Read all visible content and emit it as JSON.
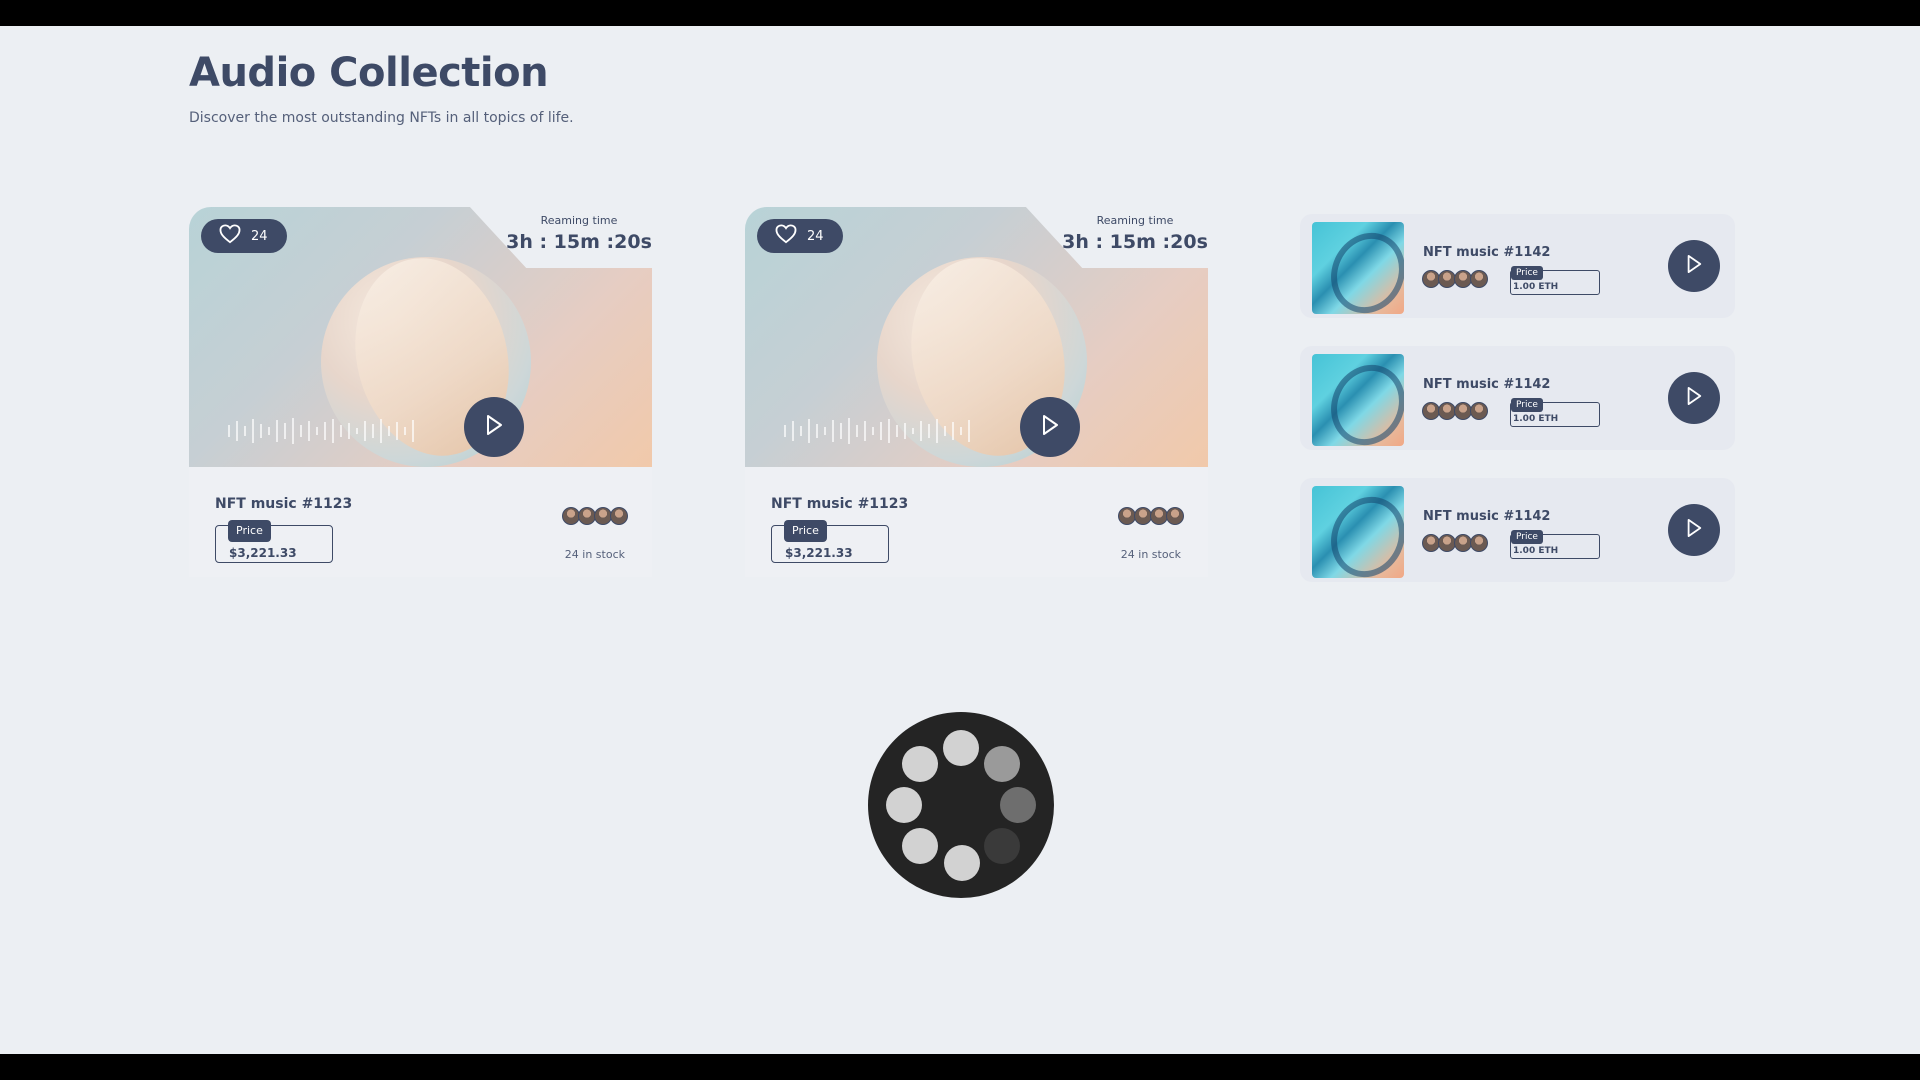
{
  "page": {
    "title": "Audio Collection",
    "subtitle": "Discover the most outstanding NFTs in all topics of life."
  },
  "featured": [
    {
      "likes": "24",
      "remaining_label": "Reaming time",
      "remaining_time": "3h : 15m :20s",
      "name": "NFT music #1123",
      "price_label": "Price",
      "price": "$3,221.33",
      "stock": "24 in stock"
    },
    {
      "likes": "24",
      "remaining_label": "Reaming time",
      "remaining_time": "3h : 15m :20s",
      "name": "NFT music #1123",
      "price_label": "Price",
      "price": "$3,221.33",
      "stock": "24 in stock"
    }
  ],
  "list": [
    {
      "name": "NFT music #1142",
      "price_label": "Price",
      "price": "1.00 ETH"
    },
    {
      "name": "NFT music #1142",
      "price_label": "Price",
      "price": "1.00 ETH"
    },
    {
      "name": "NFT music #1142",
      "price_label": "Price",
      "price": "1.00 ETH"
    }
  ],
  "icons": {
    "like": "heart-icon",
    "play": "play-icon",
    "loading": "loading-spinner"
  },
  "colors": {
    "primary": "#3e4a66",
    "background": "#eceff3"
  }
}
